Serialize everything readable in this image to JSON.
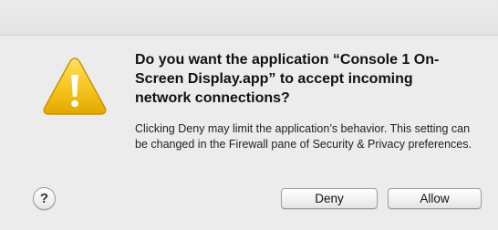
{
  "dialog": {
    "icon": "warning-triangle-icon",
    "headline": "Do you want the application “Console 1 On-Screen Display.app” to accept incoming network connections?",
    "body": "Clicking Deny may limit the application’s behavior. This setting can be changed in the Firewall pane of Security & Privacy preferences.",
    "help_label": "?",
    "deny_label": "Deny",
    "allow_label": "Allow"
  },
  "colors": {
    "warning_yellow": "#f5c51d",
    "warning_dark": "#c99400",
    "background": "#ececec"
  }
}
